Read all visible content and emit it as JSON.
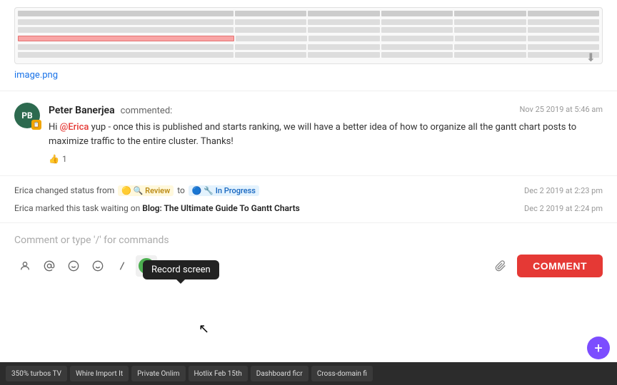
{
  "image": {
    "filename": "image.png",
    "download_tooltip": "Download"
  },
  "comment": {
    "author": "Peter Banerjea",
    "author_initials": "PB",
    "action": "commented:",
    "timestamp": "Nov 25 2019 at 5:46 am",
    "text_part1": "Hi ",
    "mention": "@Erica",
    "text_part2": " yup - once this is published and starts ranking, we will have a better idea of how to organize all the gantt chart posts to maximize traffic to the entire cluster. Thanks!",
    "like_count": "1"
  },
  "activity": [
    {
      "text_pre": "Erica changed status from",
      "from_status": "Review",
      "to_label": "to",
      "to_status": "In Progress",
      "timestamp": "Dec 2 2019 at 2:23 pm"
    },
    {
      "text_pre": "Erica marked this task waiting on",
      "task_link": "Blog: The Ultimate Guide To Gantt Charts",
      "timestamp": "Dec 2 2019 at 2:24 pm"
    }
  ],
  "comment_input": {
    "placeholder": "Comment or type '/' for commands"
  },
  "toolbar": {
    "record_screen_tooltip": "Record screen",
    "comment_button_label": "COMMENT",
    "icons": [
      {
        "name": "mention-user-icon",
        "symbol": "👤"
      },
      {
        "name": "at-mention-icon",
        "symbol": "@"
      },
      {
        "name": "emoji-icon",
        "symbol": "🙂"
      },
      {
        "name": "smiley-icon",
        "symbol": "😊"
      },
      {
        "name": "slash-command-icon",
        "symbol": "/"
      },
      {
        "name": "record-screen-icon",
        "symbol": "●"
      }
    ]
  },
  "taskbar": {
    "items": [
      "350% Iurbos TV",
      "Whire Import It",
      "Private Onlim",
      "Hotlix Feb 15th",
      "Dashboard ficr",
      "Cross-domain fi"
    ]
  },
  "fab": {
    "label": "+"
  }
}
